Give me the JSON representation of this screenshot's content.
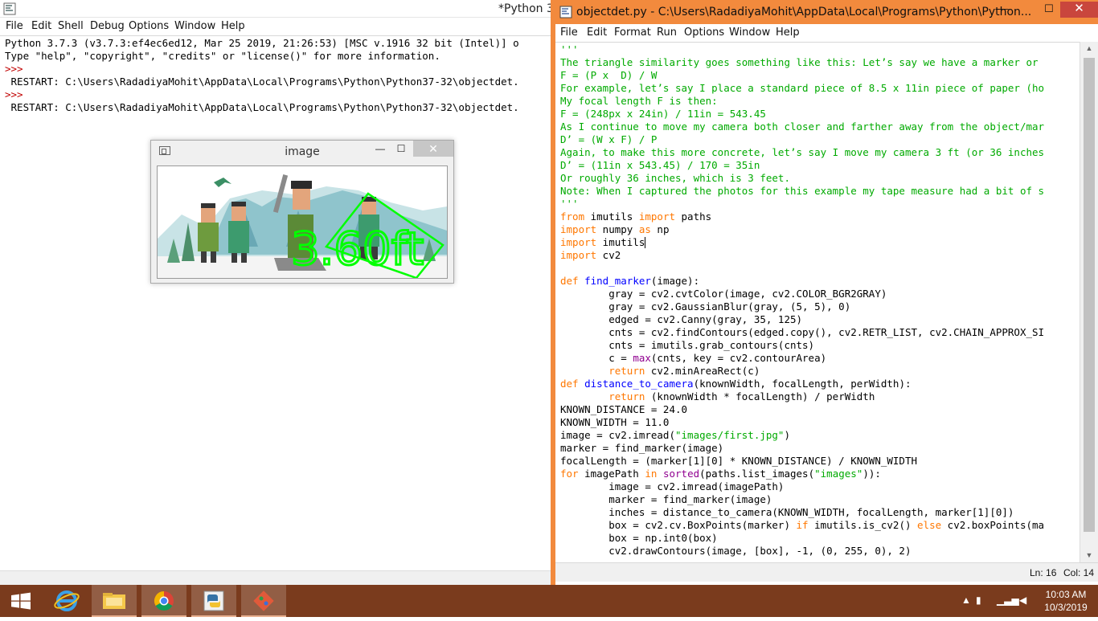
{
  "shell": {
    "title": "*Python 3",
    "menu": [
      "File",
      "Edit",
      "Shell",
      "Debug",
      "Options",
      "Window",
      "Help"
    ],
    "lines": [
      {
        "prompt": "",
        "text": "Python 3.7.3 (v3.7.3:ef4ec6ed12, Mar 25 2019, 21:26:53) [MSC v.1916 32 bit (Intel)] o"
      },
      {
        "prompt": "",
        "text": "Type \"help\", \"copyright\", \"credits\" or \"license()\" for more information."
      },
      {
        "prompt": ">>>",
        "text": ""
      },
      {
        "prompt": "",
        "text": " RESTART: C:\\Users\\RadadiyaMohit\\AppData\\Local\\Programs\\Python\\Python37-32\\objectdet."
      },
      {
        "prompt": ">>>",
        "text": ""
      },
      {
        "prompt": "",
        "text": " RESTART: C:\\Users\\RadadiyaMohit\\AppData\\Local\\Programs\\Python\\Python37-32\\objectdet."
      }
    ]
  },
  "image_window": {
    "title": "image",
    "min_glyph": "—",
    "max_glyph": "☐",
    "close_glyph": "✕",
    "overlay_text": "3.60ft"
  },
  "editor": {
    "title": "objectdet.py - C:\\Users\\RadadiyaMohit\\AppData\\Local\\Programs\\Python\\Python...",
    "menu": [
      "File",
      "Edit",
      "Format",
      "Run",
      "Options",
      "Window",
      "Help"
    ],
    "min_glyph": "—",
    "max_glyph": "☐",
    "close_glyph": "✕",
    "code": [
      [
        [
          "s",
          "'''"
        ]
      ],
      [
        [
          "s",
          "The triangle similarity goes something like this: Let’s say we have a marker or"
        ]
      ],
      [
        [
          "s",
          "F = (P x  D) / W"
        ]
      ],
      [
        [
          "s",
          "For example, let’s say I place a standard piece of 8.5 x 11in piece of paper (ho"
        ]
      ],
      [
        [
          "s",
          "My focal length F is then:"
        ]
      ],
      [
        [
          "s",
          "F = (248px x 24in) / 11in = 543.45"
        ]
      ],
      [
        [
          "s",
          "As I continue to move my camera both closer and farther away from the object/mar"
        ]
      ],
      [
        [
          "s",
          "D’ = (W x F) / P"
        ]
      ],
      [
        [
          "s",
          "Again, to make this more concrete, let’s say I move my camera 3 ft (or 36 inches"
        ]
      ],
      [
        [
          "s",
          "D’ = (11in x 543.45) / 170 = 35in"
        ]
      ],
      [
        [
          "s",
          "Or roughly 36 inches, which is 3 feet."
        ]
      ],
      [
        [
          "s",
          "Note: When I captured the photos for this example my tape measure had a bit of s"
        ]
      ],
      [
        [
          "s",
          "'''"
        ]
      ],
      [
        [
          "k",
          "from"
        ],
        [
          "n",
          " imutils "
        ],
        [
          "k",
          "import"
        ],
        [
          "n",
          " paths"
        ]
      ],
      [
        [
          "k",
          "import"
        ],
        [
          "n",
          " numpy "
        ],
        [
          "k",
          "as"
        ],
        [
          "n",
          " np"
        ]
      ],
      [
        [
          "k",
          "import"
        ],
        [
          "n",
          " imutils"
        ]
      ],
      [
        [
          "k",
          "import"
        ],
        [
          "n",
          " cv2"
        ]
      ],
      [
        [
          "n",
          ""
        ]
      ],
      [
        [
          "k",
          "def"
        ],
        [
          "n",
          " "
        ],
        [
          "d",
          "find_marker"
        ],
        [
          "n",
          "(image):"
        ]
      ],
      [
        [
          "n",
          "        gray = cv2.cvtColor(image, cv2.COLOR_BGR2GRAY)"
        ]
      ],
      [
        [
          "n",
          "        gray = cv2.GaussianBlur(gray, (5, 5), 0)"
        ]
      ],
      [
        [
          "n",
          "        edged = cv2.Canny(gray, 35, 125)"
        ]
      ],
      [
        [
          "n",
          "        cnts = cv2.findContours(edged.copy(), cv2.RETR_LIST, cv2.CHAIN_APPROX_SI"
        ]
      ],
      [
        [
          "n",
          "        cnts = imutils.grab_contours(cnts)"
        ]
      ],
      [
        [
          "n",
          "        c = "
        ],
        [
          "b",
          "max"
        ],
        [
          "n",
          "(cnts, key = cv2.contourArea)"
        ]
      ],
      [
        [
          "n",
          "        "
        ],
        [
          "k",
          "return"
        ],
        [
          "n",
          " cv2.minAreaRect(c)"
        ]
      ],
      [
        [
          "k",
          "def"
        ],
        [
          "n",
          " "
        ],
        [
          "d",
          "distance_to_camera"
        ],
        [
          "n",
          "(knownWidth, focalLength, perWidth):"
        ]
      ],
      [
        [
          "n",
          "        "
        ],
        [
          "k",
          "return"
        ],
        [
          "n",
          " (knownWidth * focalLength) / perWidth"
        ]
      ],
      [
        [
          "n",
          "KNOWN_DISTANCE = 24.0"
        ]
      ],
      [
        [
          "n",
          "KNOWN_WIDTH = 11.0"
        ]
      ],
      [
        [
          "n",
          "image = cv2.imread("
        ],
        [
          "s",
          "\"images/first.jpg\""
        ],
        [
          "n",
          ")"
        ]
      ],
      [
        [
          "n",
          "marker = find_marker(image)"
        ]
      ],
      [
        [
          "n",
          "focalLength = (marker[1][0] * KNOWN_DISTANCE) / KNOWN_WIDTH"
        ]
      ],
      [
        [
          "k",
          "for"
        ],
        [
          "n",
          " imagePath "
        ],
        [
          "k",
          "in"
        ],
        [
          "n",
          " "
        ],
        [
          "b",
          "sorted"
        ],
        [
          "n",
          "(paths.list_images("
        ],
        [
          "s",
          "\"images\""
        ],
        [
          "n",
          ")):"
        ]
      ],
      [
        [
          "n",
          "        image = cv2.imread(imagePath)"
        ]
      ],
      [
        [
          "n",
          "        marker = find_marker(image)"
        ]
      ],
      [
        [
          "n",
          "        inches = distance_to_camera(KNOWN_WIDTH, focalLength, marker[1][0])"
        ]
      ],
      [
        [
          "n",
          "        box = cv2.cv.BoxPoints(marker) "
        ],
        [
          "k",
          "if"
        ],
        [
          "n",
          " imutils.is_cv2() "
        ],
        [
          "k",
          "else"
        ],
        [
          "n",
          " cv2.boxPoints(ma"
        ]
      ],
      [
        [
          "n",
          "        box = np.int0(box)"
        ]
      ],
      [
        [
          "n",
          "        cv2.drawContours(image, [box], -1, (0, 255, 0), 2)"
        ]
      ]
    ],
    "status": {
      "line": "Ln: 16",
      "col": "Col: 14"
    }
  },
  "taskbar": {
    "apps": [
      "start-button",
      "internet-explorer",
      "file-explorer",
      "chrome",
      "python-idle",
      "git-gui"
    ],
    "clock": {
      "time": "10:03 AM",
      "date": "10/3/2019"
    }
  },
  "colors": {
    "editor_accent": "#f28a3d",
    "taskbar": "#7a3b1d",
    "string": "#00aa00",
    "keyword": "#ff7700",
    "definition": "#0000ff",
    "builtin": "#900090",
    "prompt": "#c00000"
  }
}
